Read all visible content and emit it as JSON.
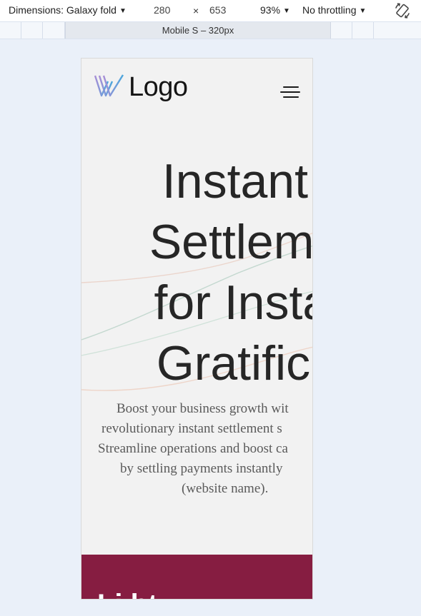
{
  "toolbar": {
    "dimensions_label": "Dimensions: Galaxy fold",
    "width_value": "280",
    "times_symbol": "×",
    "height_value": "653",
    "zoom": "93%",
    "throttling": "No throttling",
    "rotate_icon": "rotate-device-icon"
  },
  "media_query": {
    "label": "Mobile S – 320px"
  },
  "site": {
    "logo_text": "Logo",
    "logo_icon": "w-logo-icon",
    "menu_icon": "hamburger-menu-icon",
    "hero_title_lines": [
      "Instant",
      "Settlemen",
      "for Instan",
      "Gratificati"
    ],
    "hero_desc_lines": [
      "Boost your business growth wit",
      "revolutionary instant settlement s",
      "Streamline operations and boost ca",
      "by settling payments instantly",
      "(website name)."
    ],
    "band_text": "Li ht"
  },
  "colors": {
    "page_bg": "#eaf0f9",
    "viewport_bg": "#f2f2f2",
    "accent_band": "#861d41",
    "logo_gradient_start": "#a88ed6",
    "logo_gradient_end": "#4aa6dc"
  }
}
